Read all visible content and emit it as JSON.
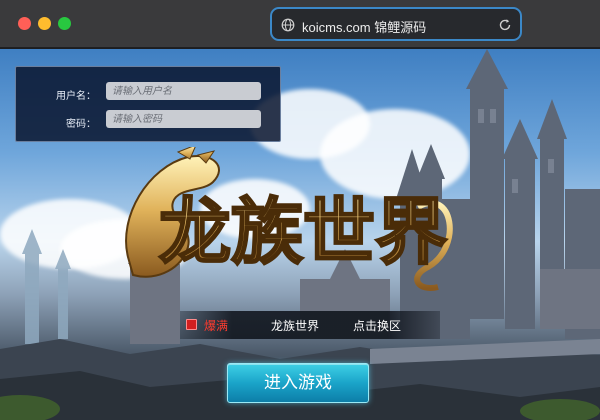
{
  "browser": {
    "url": "koicms.com 锦鲤源码",
    "icons": {
      "site": "globe-icon",
      "reload": "reload-icon"
    }
  },
  "login": {
    "username_label": "用户名：",
    "username_placeholder": "请输入用户名",
    "password_label": "密码：",
    "password_placeholder": "请输入密码"
  },
  "logo": {
    "text": "龙族世界"
  },
  "server": {
    "status": "爆满",
    "status_color": "#d21f1f",
    "name": "龙族世界",
    "switch_label": "点击换区"
  },
  "enter_button": {
    "label": "进入游戏"
  },
  "colors": {
    "accent": "#3b88c8",
    "button": "#1aa4c9",
    "panel": "#0a1630"
  }
}
